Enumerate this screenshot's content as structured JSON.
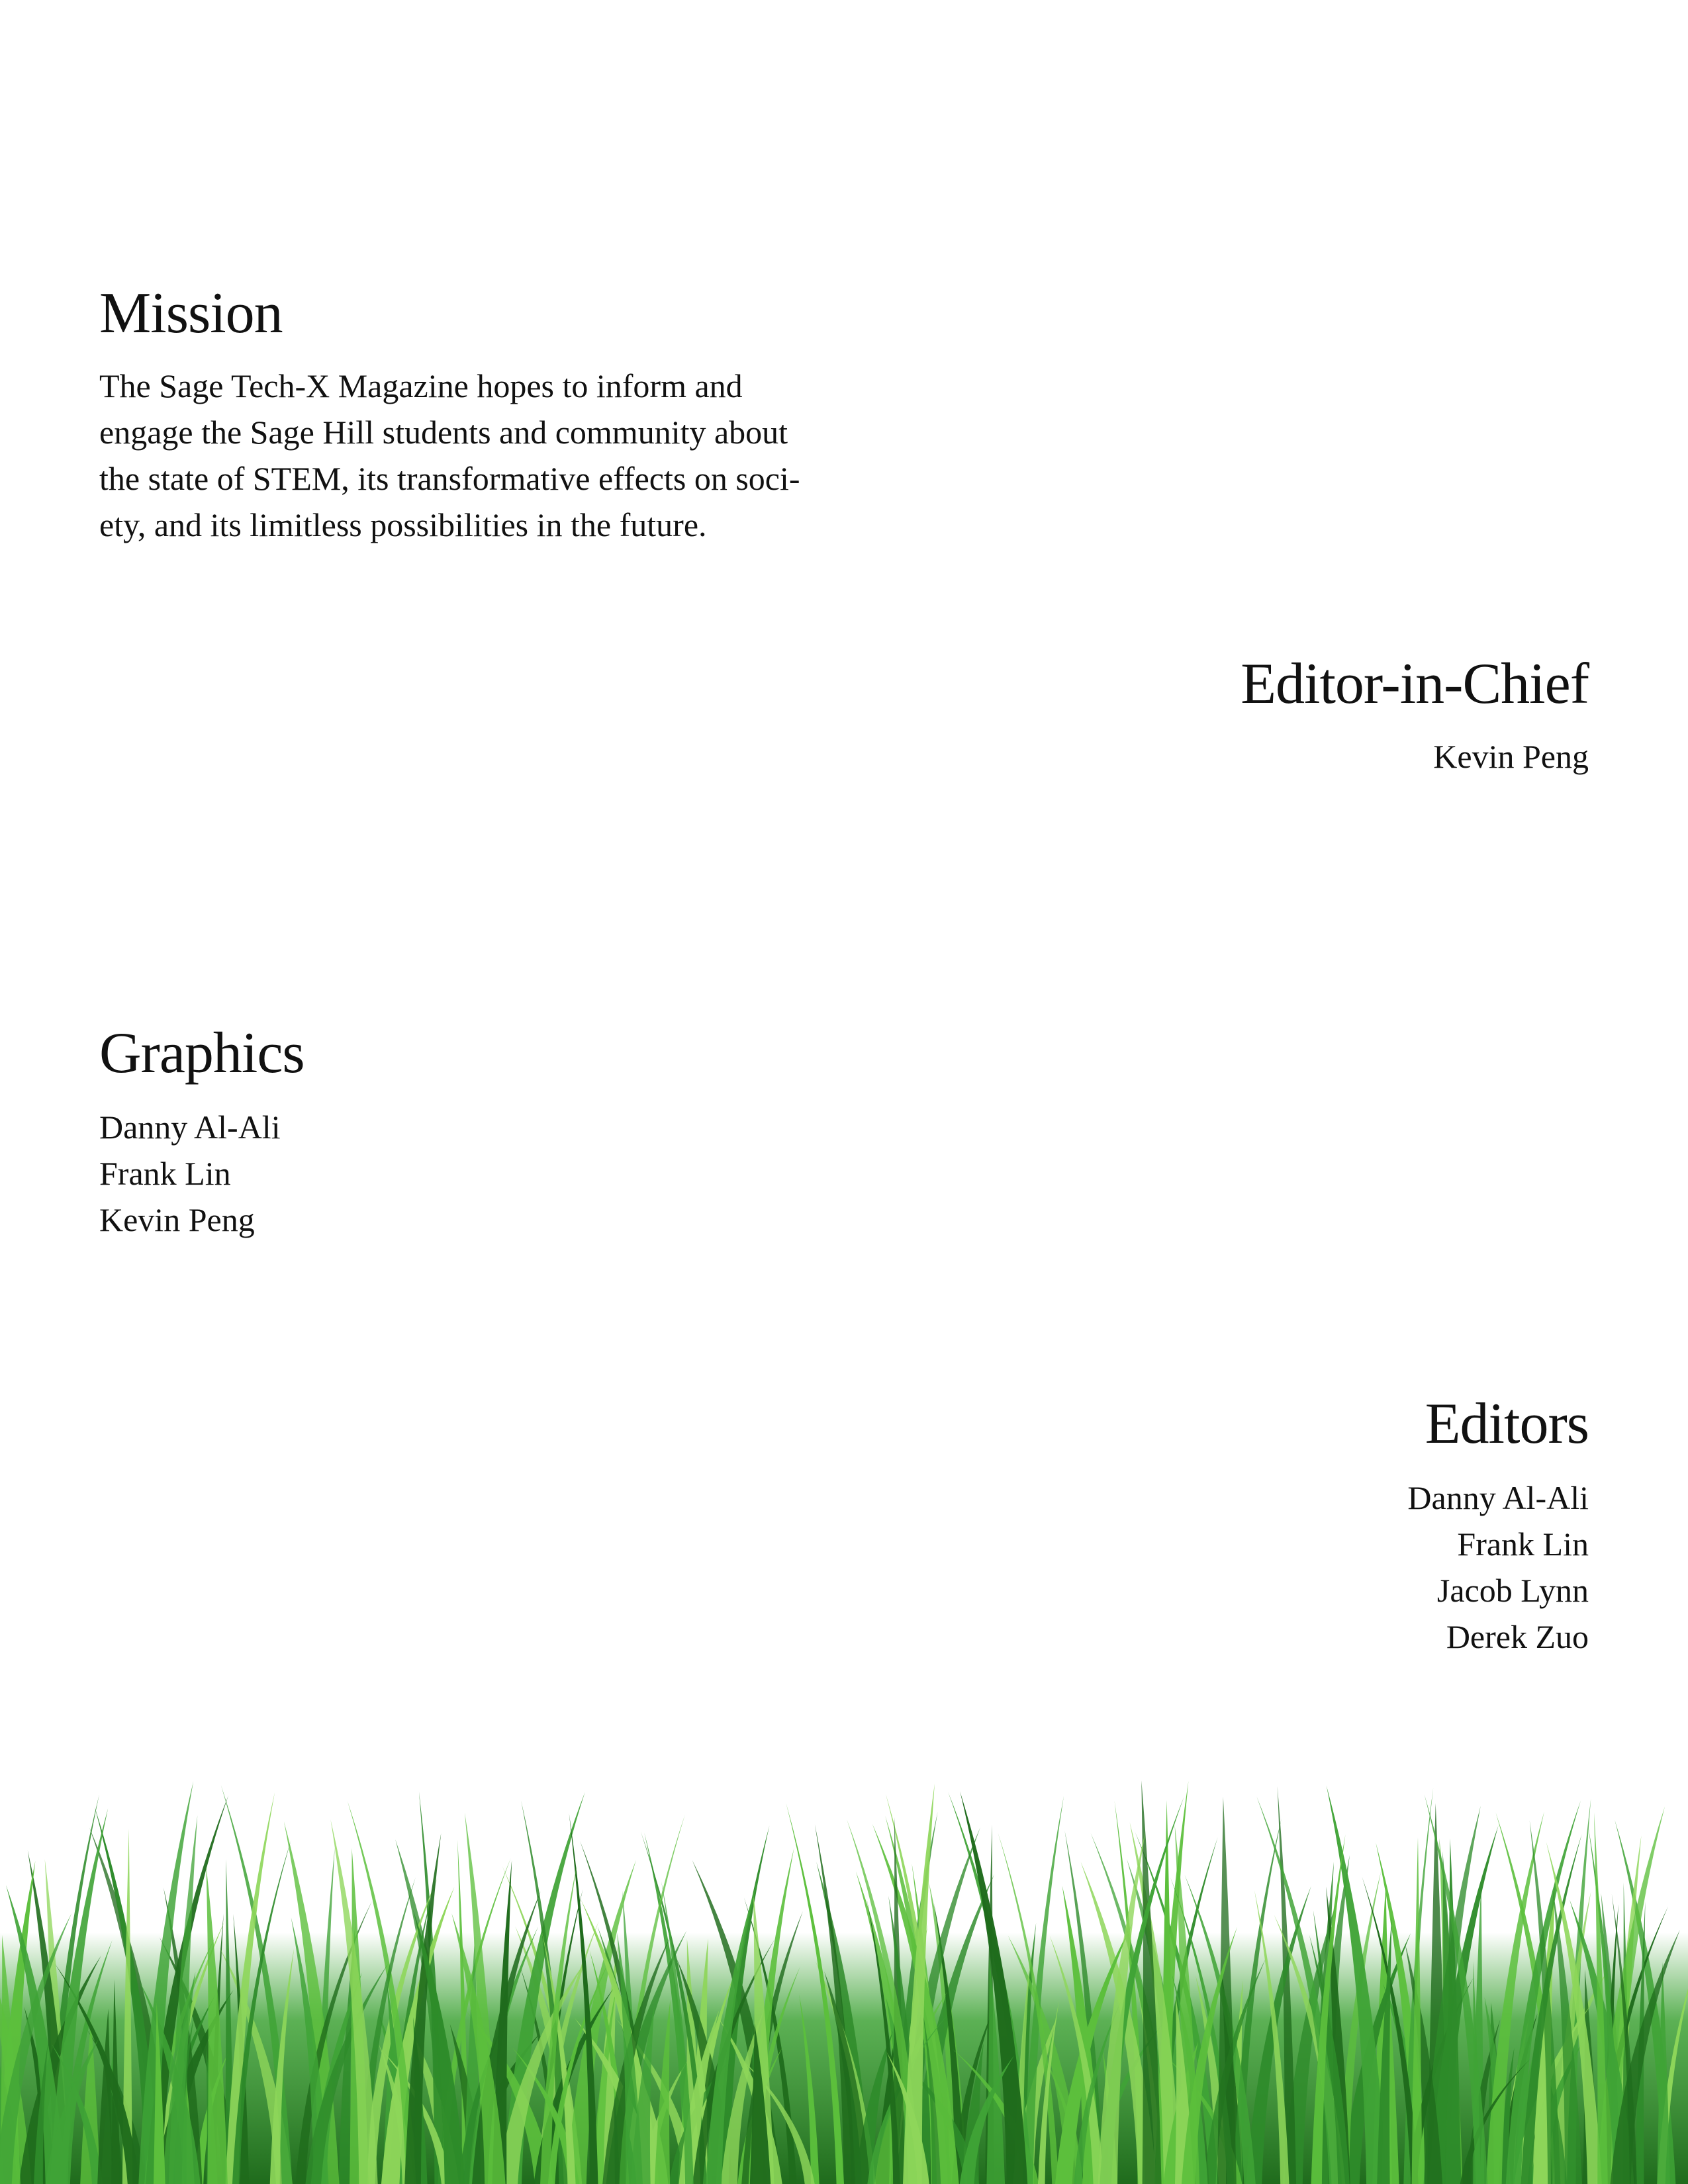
{
  "mission": {
    "title": "Mission",
    "lines": [
      "The Sage Tech-X Magazine hopes to inform and",
      "engage the Sage Hill students and community about",
      "the state of STEM, its transformative effects on soci-",
      "ety, and its limitless possibilities in the future."
    ]
  },
  "editor_in_chief": {
    "title": "Editor-in-Chief",
    "name": "Kevin Peng"
  },
  "graphics": {
    "title": "Graphics",
    "names": [
      "Danny Al-Ali",
      "Frank Lin",
      "Kevin Peng"
    ]
  },
  "editors": {
    "title": "Editors",
    "names": [
      "Danny Al-Ali",
      "Frank Lin",
      "Jacob Lynn",
      "Derek Zuo"
    ]
  },
  "decoration": {
    "grass_colors": [
      "#1f6b1c",
      "#2e8b2a",
      "#3fa336",
      "#5cbf3c",
      "#8ed65a"
    ]
  }
}
